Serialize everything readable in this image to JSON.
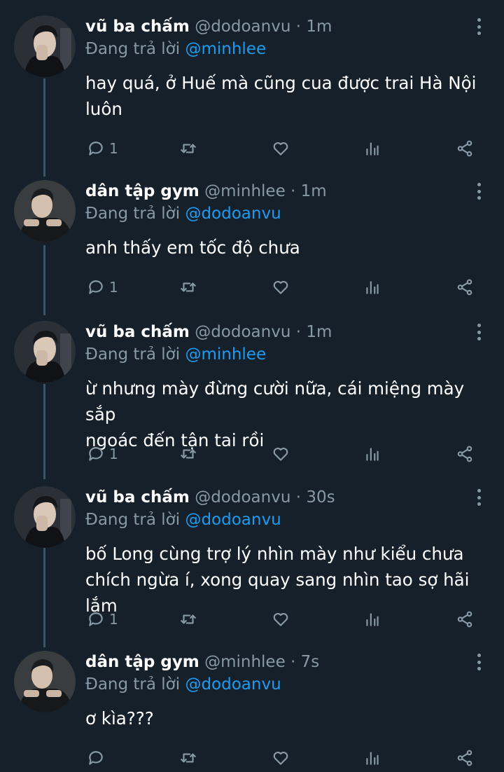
{
  "colors": {
    "background": "#15202b",
    "text": "#ffffff",
    "muted": "#8899a6",
    "mention": "#1d9bf0",
    "thread_line": "#3d5466"
  },
  "replying_label": "Đang trả lời",
  "tweets": [
    {
      "name": "vũ ba chấm",
      "handle": "@dodoanvu",
      "time": "1m",
      "reply_to": "@minhlee",
      "text_lines": [
        "hay quá, ở Huế mà cũng cua được trai Hà Nội",
        "luôn"
      ],
      "reply_count": "1"
    },
    {
      "name": "dân tập gym",
      "handle": "@minhlee",
      "time": "1m",
      "reply_to": "@dodoanvu",
      "text_lines": [
        "anh thấy em tốc độ chưa"
      ],
      "reply_count": "1"
    },
    {
      "name": "vũ ba chấm",
      "handle": "@dodoanvu",
      "time": "1m",
      "reply_to": "@minhlee",
      "text_lines": [
        "ừ nhưng mày đừng cười nữa, cái miệng mày sắp",
        "ngoác đến tận tai rồi"
      ],
      "reply_count": "1"
    },
    {
      "name": "vũ ba chấm",
      "handle": "@dodoanvu",
      "time": "30s",
      "reply_to": "@dodoanvu",
      "text_lines": [
        "bố Long cùng trợ lý nhìn mày như kiểu chưa",
        "chích ngừa í, xong quay sang nhìn tao sợ hãi lắm"
      ],
      "reply_count": "1"
    },
    {
      "name": "dân tập gym",
      "handle": "@minhlee",
      "time": "7s",
      "reply_to": "@dodoanvu",
      "text_lines": [
        "ơ kìa???"
      ],
      "reply_count": ""
    }
  ]
}
